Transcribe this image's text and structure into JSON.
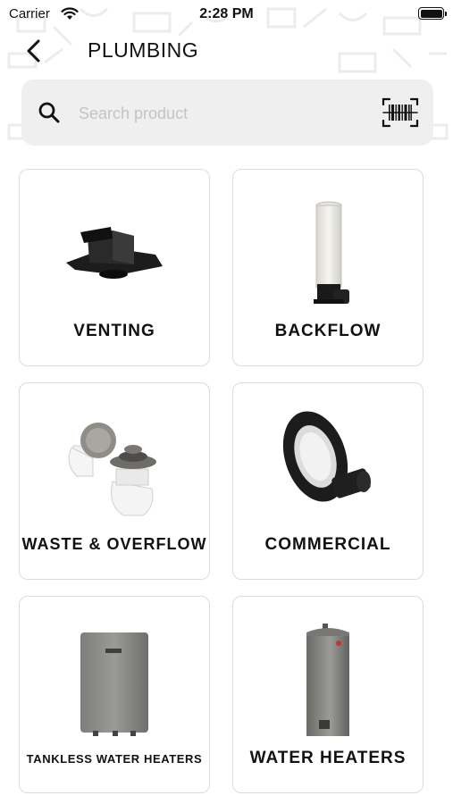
{
  "status_bar": {
    "carrier": "Carrier",
    "time": "2:28 PM"
  },
  "nav": {
    "title": "PLUMBING"
  },
  "search": {
    "placeholder": "Search product"
  },
  "categories": [
    {
      "label": "VENTING"
    },
    {
      "label": "BACKFLOW"
    },
    {
      "label": "WASTE & OVERFLOW"
    },
    {
      "label": "COMMERCIAL"
    },
    {
      "label": "TANKLESS WATER HEATERS"
    },
    {
      "label": "WATER HEATERS"
    }
  ],
  "icons": [
    "wifi-icon",
    "battery-icon",
    "back-chevron-icon",
    "search-icon",
    "barcode-scanner-icon"
  ]
}
